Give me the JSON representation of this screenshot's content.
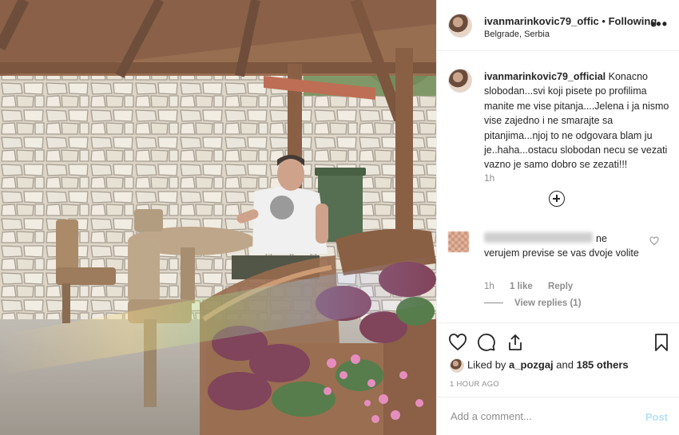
{
  "post": {
    "username": "ivanmarinkovic79_offic",
    "separator": "•",
    "follow_status": "Following",
    "location": "Belgrade, Serbia",
    "more_label": "•••"
  },
  "caption": {
    "username": "ivanmarinkovic79_official",
    "text": "Konacno slobodan...svi koji pisete po profilima manite me vise pitanja....Jelena i ja nismo vise zajedno i ne smarajte sa pitanjima...njoj to ne odgovara blam ju je..haha...ostacu slobodan necu se vezati vazno je samo dobro se zezati!!!",
    "time": "1h"
  },
  "comment": {
    "text": "ne verujem previse se vas dvoje volite",
    "time": "1h",
    "likes": "1 like",
    "reply_label": "Reply",
    "view_replies": "View replies (1)"
  },
  "likes": {
    "prefix": "Liked by ",
    "user": "a_pozgaj",
    "suffix": " and ",
    "others": "185 others"
  },
  "timestamp": "1 HOUR AGO",
  "add_comment": {
    "placeholder": "Add a comment...",
    "post_label": "Post"
  },
  "colors": {
    "text": "#262626",
    "muted": "#8e8e8e",
    "post_disabled": "#b2dffc",
    "border": "#efefef"
  }
}
